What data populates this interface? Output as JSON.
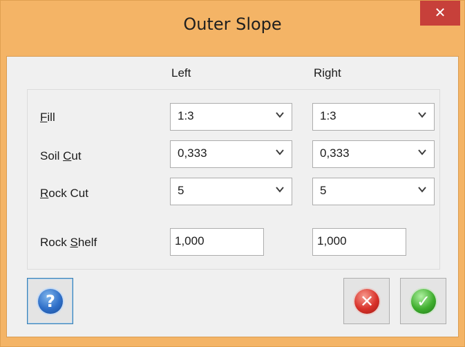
{
  "window": {
    "title": "Outer Slope",
    "close_glyph": "✕"
  },
  "columns": {
    "left": "Left",
    "right": "Right"
  },
  "rows": {
    "fill": {
      "label_prefix": "",
      "label_mnemonic": "F",
      "label_suffix": "ill",
      "left_value": "1:3",
      "right_value": "1:3"
    },
    "soil_cut": {
      "label_prefix": "Soil ",
      "label_mnemonic": "C",
      "label_suffix": "ut",
      "left_value": "0,333",
      "right_value": "0,333"
    },
    "rock_cut": {
      "label_prefix": "",
      "label_mnemonic": "R",
      "label_suffix": "ock Cut",
      "left_value": "5",
      "right_value": "5"
    },
    "rock_shelf": {
      "label_prefix": "Rock ",
      "label_mnemonic": "S",
      "label_suffix": "helf",
      "left_value": "1,000",
      "right_value": "1,000"
    }
  },
  "icons": {
    "dropdown": "chevron-down-icon",
    "help": "help-icon",
    "cancel": "cancel-icon",
    "ok": "ok-check-icon",
    "close": "close-icon"
  },
  "glyphs": {
    "chevron": "⌄",
    "help": "?",
    "cancel": "✕",
    "ok": "✓"
  },
  "colors": {
    "title_bar": "#f4b466",
    "close_button": "#c7403a",
    "client_bg": "#f0f0f0",
    "help_blue": "#2f6fc8",
    "cancel_red": "#d8322a",
    "ok_green": "#3fae2e"
  }
}
